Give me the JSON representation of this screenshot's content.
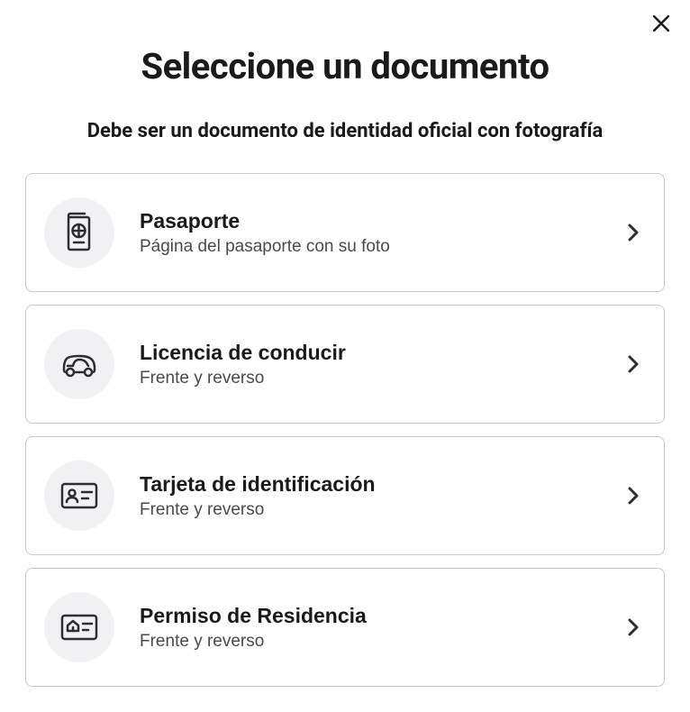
{
  "header": {
    "title": "Seleccione un documento",
    "subtitle": "Debe ser un documento de identidad oficial con fotografía"
  },
  "options": [
    {
      "title": "Pasaporte",
      "description": "Página del pasaporte con su foto"
    },
    {
      "title": "Licencia de conducir",
      "description": "Frente y reverso"
    },
    {
      "title": "Tarjeta de identificación",
      "description": "Frente y reverso"
    },
    {
      "title": "Permiso de Residencia",
      "description": "Frente y reverso"
    }
  ]
}
